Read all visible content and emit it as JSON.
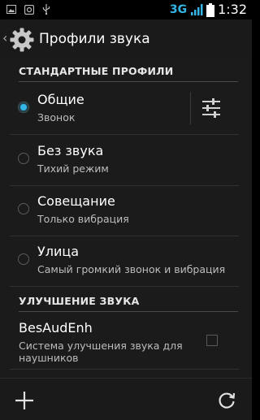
{
  "status_bar": {
    "network_type": "3G",
    "time": "1:32",
    "left_icons": [
      "image-icon",
      "camera-app-icon",
      "usb-icon"
    ],
    "accent_color": "#33b5e5"
  },
  "action_bar": {
    "back_glyph": "‹",
    "title": "Профили звука"
  },
  "sections": {
    "standard_profiles": "СТАНДАРТНЫЕ ПРОФИЛИ",
    "sound_enhancement": "УЛУЧШЕНИЕ ЗВУКА"
  },
  "profiles": [
    {
      "title": "Общие",
      "subtitle": "Звонок",
      "selected": true
    },
    {
      "title": "Без звука",
      "subtitle": "Тихий режим",
      "selected": false
    },
    {
      "title": "Совещание",
      "subtitle": "Только вибрация",
      "selected": false
    },
    {
      "title": "Улица",
      "subtitle": "Самый громкий звонок и вибрация",
      "selected": false
    }
  ],
  "enhancement": {
    "title": "BesAudEnh",
    "subtitle": "Система улучшения звука для наушников",
    "checked": false
  },
  "bottom_bar": {
    "add_icon": "plus-icon",
    "reset_icon": "reset-icon"
  }
}
